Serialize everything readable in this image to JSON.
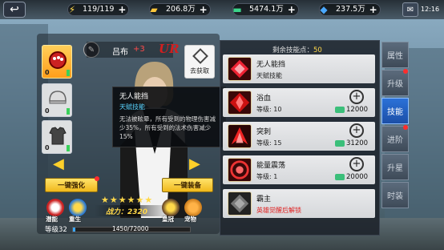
{
  "topbar": {
    "stamina": "119/119",
    "gold": "206.8万",
    "cash": "5474.1万",
    "diamond": "237.5万",
    "clock": "12:16"
  },
  "hero": {
    "name": "吕布",
    "plus": "+3",
    "rarity": "UR",
    "unload_label": "去获取",
    "power": "战力：2320",
    "stars": 6,
    "level_label": "等级32",
    "exp_text": "1450/72000",
    "exp_fraction": 0.02,
    "potential_label": "潜能",
    "rebirth_label": "重生",
    "wardrobe_label": "皇冠",
    "pet_label": "宠物",
    "equip_slots": [
      {
        "count": "0"
      },
      {
        "count": "0"
      },
      {
        "count": "0"
      }
    ]
  },
  "buttons": {
    "enhance": "一键强化",
    "equip": "一键装备"
  },
  "tooltip": {
    "title": "无人能挡",
    "type": "天赋技能",
    "desc": "无法被眩晕，所有受到的物理伤害减少35%，所有受到的法术伤害减少15%"
  },
  "skills": {
    "points_label": "剩余技能点：",
    "points_value": "50",
    "list": [
      {
        "name": "无人能挡",
        "sub": "天赋技能",
        "cost": ""
      },
      {
        "name": "浴血",
        "sub": "等级: 10",
        "cost": "12000"
      },
      {
        "name": "突刺",
        "sub": "等级: 15",
        "cost": "31200"
      },
      {
        "name": "能量震荡",
        "sub": "等级: 1",
        "cost": "20000"
      },
      {
        "name": "霸主",
        "sub": "英雄觉醒后解锁",
        "cost": ""
      }
    ]
  },
  "tabs": [
    "属性",
    "升级",
    "技能",
    "进阶",
    "升星",
    "时装"
  ]
}
